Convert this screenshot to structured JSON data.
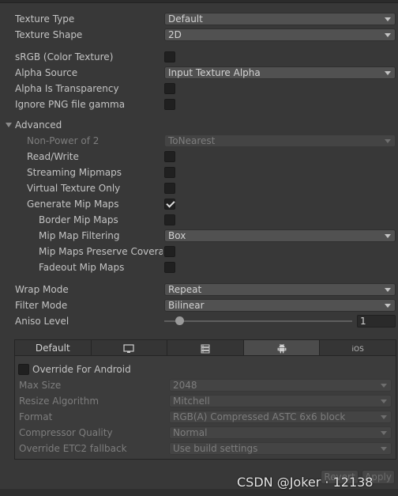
{
  "texture_type": {
    "label": "Texture Type",
    "value": "Default"
  },
  "texture_shape": {
    "label": "Texture Shape",
    "value": "2D"
  },
  "srgb": {
    "label": "sRGB (Color Texture)",
    "checked": false
  },
  "alpha_source": {
    "label": "Alpha Source",
    "value": "Input Texture Alpha"
  },
  "alpha_transparency": {
    "label": "Alpha Is Transparency",
    "checked": false
  },
  "ignore_png_gamma": {
    "label": "Ignore PNG file gamma",
    "checked": false
  },
  "advanced": {
    "label": "Advanced",
    "non_power_of_2": {
      "label": "Non-Power of 2",
      "value": "ToNearest"
    },
    "read_write": {
      "label": "Read/Write",
      "checked": false
    },
    "streaming_mipmaps": {
      "label": "Streaming Mipmaps",
      "checked": false
    },
    "virtual_texture_only": {
      "label": "Virtual Texture Only",
      "checked": false
    },
    "generate_mip_maps": {
      "label": "Generate Mip Maps",
      "checked": true
    },
    "border_mip_maps": {
      "label": "Border Mip Maps",
      "checked": false
    },
    "mip_map_filtering": {
      "label": "Mip Map Filtering",
      "value": "Box"
    },
    "mip_maps_preserve_coverage": {
      "label": "Mip Maps Preserve Coverage",
      "checked": false
    },
    "fadeout_mip_maps": {
      "label": "Fadeout Mip Maps",
      "checked": false
    }
  },
  "wrap_mode": {
    "label": "Wrap Mode",
    "value": "Repeat"
  },
  "filter_mode": {
    "label": "Filter Mode",
    "value": "Bilinear"
  },
  "aniso_level": {
    "label": "Aniso Level",
    "value": "1"
  },
  "platform_tabs": {
    "default": "Default",
    "standalone_icon": "monitor-icon",
    "server_icon": "server-icon",
    "android_icon": "android-icon",
    "ios": "iOS",
    "active": "android"
  },
  "android": {
    "override": {
      "label": "Override For Android",
      "checked": false
    },
    "max_size": {
      "label": "Max Size",
      "value": "2048"
    },
    "resize_algorithm": {
      "label": "Resize Algorithm",
      "value": "Mitchell"
    },
    "format": {
      "label": "Format",
      "value": "RGB(A) Compressed ASTC 6x6 block"
    },
    "compressor_quality": {
      "label": "Compressor Quality",
      "value": "Normal"
    },
    "override_etc2": {
      "label": "Override ETC2 fallback",
      "value": "Use build settings"
    }
  },
  "buttons": {
    "revert": "Revert",
    "apply": "Apply"
  },
  "watermark": "CSDN @Joker · 12138"
}
